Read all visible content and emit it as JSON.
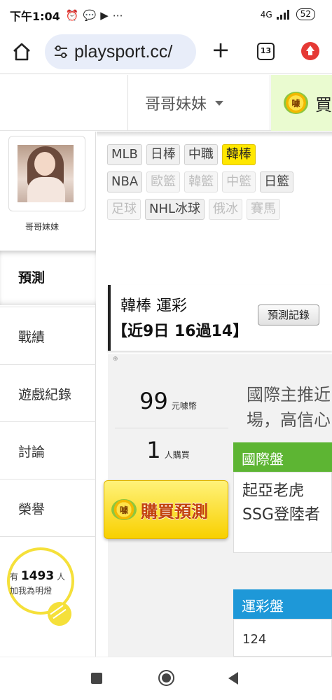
{
  "status_bar": {
    "time": "下午1:04",
    "network": "4G",
    "battery": "52"
  },
  "browser": {
    "url": "playsport.cc/",
    "tab_count": "13"
  },
  "header": {
    "user_name": "哥哥妹妹",
    "buy_label": "買"
  },
  "coin_icon_text": "噱",
  "profile": {
    "name": "哥哥妹妹"
  },
  "sidebar": {
    "items": [
      {
        "label": "預測"
      },
      {
        "label": "戰績"
      },
      {
        "label": "遊戲紀錄"
      },
      {
        "label": "討論"
      },
      {
        "label": "榮譽"
      }
    ],
    "light": {
      "prefix": "有",
      "count": "1493",
      "suffix": "人",
      "sub": "加我為明燈"
    }
  },
  "tags": {
    "row1": [
      {
        "label": "MLB",
        "state": "normal"
      },
      {
        "label": "日棒",
        "state": "normal"
      },
      {
        "label": "中職",
        "state": "normal"
      },
      {
        "label": "韓棒",
        "state": "active"
      }
    ],
    "row2": [
      {
        "label": "NBA",
        "state": "normal"
      },
      {
        "label": "歐籃",
        "state": "dim"
      },
      {
        "label": "韓籃",
        "state": "dim"
      },
      {
        "label": "中籃",
        "state": "dim"
      },
      {
        "label": "日籃",
        "state": "normal"
      }
    ],
    "row3": [
      {
        "label": "足球",
        "state": "dim"
      },
      {
        "label": "NHL冰球",
        "state": "normal"
      },
      {
        "label": "俄冰",
        "state": "dim"
      },
      {
        "label": "賽馬",
        "state": "dim"
      }
    ]
  },
  "prediction": {
    "title": "韓棒 運彩",
    "record": "【近9日 16過14】",
    "log_button": "預測記錄"
  },
  "purchase": {
    "price": "99",
    "price_unit": "元噱幣",
    "buyers": "1",
    "buyers_unit": "人購買",
    "button": "購買預測"
  },
  "intro": {
    "line1": "國際主推近",
    "line2": "場，高信心"
  },
  "international": {
    "header": "國際盤",
    "teams": [
      "起亞老虎",
      "SSG登陸者"
    ]
  },
  "lottery": {
    "header": "運彩盤",
    "value": "124"
  },
  "colors": {
    "active_tag": "#ffe700",
    "intl_header": "#5db533",
    "lottery_header": "#1e98d8",
    "buy_button": "#f8d000",
    "buy_text": "#c2410c"
  }
}
